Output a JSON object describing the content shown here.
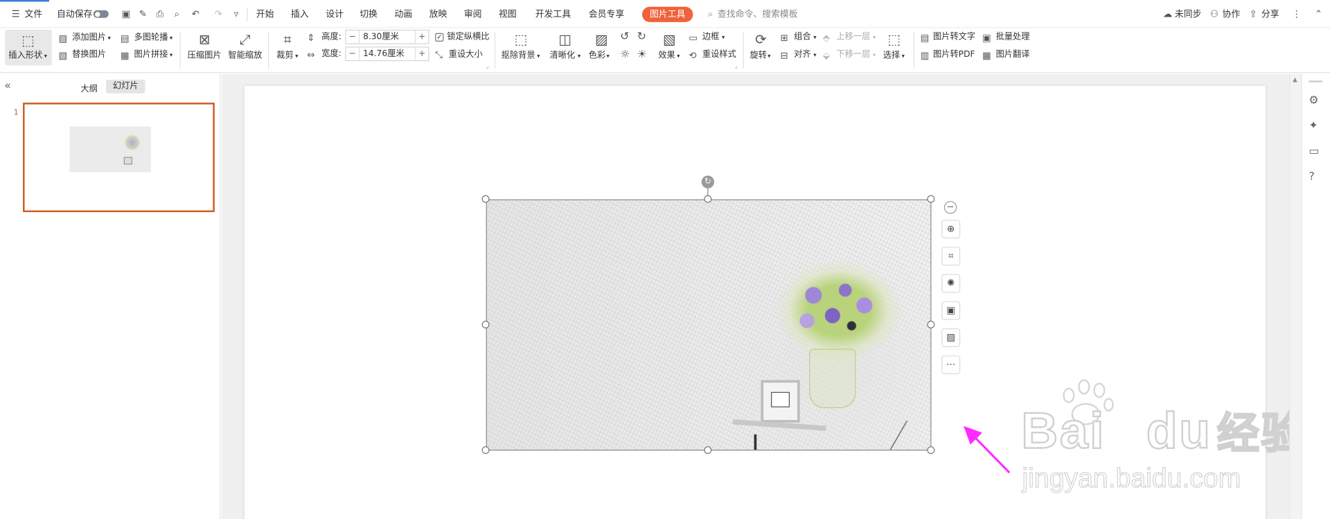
{
  "menubar": {
    "file_label": "文件",
    "autosave_label": "自动保存",
    "tabs": [
      "开始",
      "插入",
      "设计",
      "切换",
      "动画",
      "放映",
      "审阅",
      "视图",
      "开发工具",
      "会员专享"
    ],
    "active_tab": "图片工具",
    "search_placeholder": "查找命令、搜索模板",
    "unsync": "未同步",
    "collab": "协作",
    "share": "分享"
  },
  "toolbar": {
    "insert_shape": "插入形状",
    "add_image": "添加图片",
    "replace_image": "替换图片",
    "multi_outline": "多图轮播",
    "image_stitch": "图片拼接",
    "compress": "压缩图片",
    "smart_zoom": "智能缩放",
    "crop": "裁剪",
    "height_label": "高度:",
    "height_value": "8.30厘米",
    "width_label": "宽度:",
    "width_value": "14.76厘米",
    "lock_ratio": "锁定纵横比",
    "reset_size": "重设大小",
    "remove_bg": "抠除背景",
    "sharpen": "清晰化",
    "color": "色彩",
    "effect": "效果",
    "border": "边框",
    "reset_style": "重设样式",
    "rotate": "旋转",
    "group": "组合",
    "align": "对齐",
    "bring_forward": "上移一层",
    "send_backward": "下移一层",
    "select": "选择",
    "img_to_text": "图片转文字",
    "img_to_pdf": "图片转PDF",
    "batch": "批量处理",
    "img_translate": "图片翻译"
  },
  "leftpanel": {
    "tab_outline": "大纲",
    "tab_slides": "幻灯片",
    "slide_number": "1"
  },
  "watermark": {
    "brand": "Bai",
    "brand2": "du",
    "cn": "经验",
    "url": "jingyan.baidu.com"
  },
  "colors": {
    "accent": "#f0623a",
    "thumb_border": "#d0591f",
    "arrow": "#ff2aff"
  }
}
